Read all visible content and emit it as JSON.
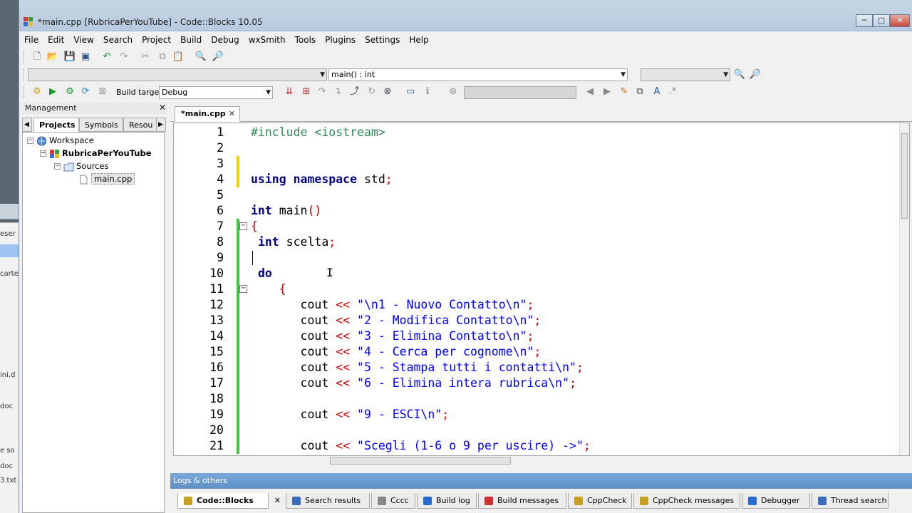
{
  "window": {
    "title": "*main.cpp [RubricaPerYouTube] - Code::Blocks 10.05",
    "min": "─",
    "max": "□",
    "close": "✕"
  },
  "menu": [
    "File",
    "Edit",
    "View",
    "Search",
    "Project",
    "Build",
    "Debug",
    "wxSmith",
    "Tools",
    "Plugins",
    "Settings",
    "Help"
  ],
  "toolbar": {
    "scope_value": "",
    "function_value": "main() : int",
    "build_target_label": "Build target:",
    "build_target_value": "Debug"
  },
  "management": {
    "title": "Management",
    "close": "✕",
    "tabs": [
      "Projects",
      "Symbols",
      "Resou"
    ],
    "tree": {
      "workspace": "Workspace",
      "project": "RubricaPerYouTube",
      "folder": "Sources",
      "file": "main.cpp"
    }
  },
  "editor": {
    "tab_label": "*main.cpp",
    "tab_close": "✕"
  },
  "code_lines": [
    {
      "n": "1",
      "html": "<span class='pp'>#include &lt;iostream&gt;</span>",
      "chg": "",
      "fold": ""
    },
    {
      "n": "2",
      "html": "",
      "chg": "",
      "fold": ""
    },
    {
      "n": "3",
      "html": "",
      "chg": "#f0d000",
      "fold": ""
    },
    {
      "n": "4",
      "html": "<span class='kw'>using namespace</span> std<span class='op'>;</span>",
      "chg": "#f0d000",
      "fold": ""
    },
    {
      "n": "5",
      "html": "",
      "chg": "",
      "fold": ""
    },
    {
      "n": "6",
      "html": "<span class='kw'>int</span> main<span class='op'>()</span>",
      "chg": "",
      "fold": ""
    },
    {
      "n": "7",
      "html": "<span class='op'>{</span>",
      "chg": "#3cc83c",
      "fold": "⊟"
    },
    {
      "n": "8",
      "html": " <span class='kw'>int</span> scelta<span class='op'>;</span>",
      "chg": "#3cc83c",
      "fold": ""
    },
    {
      "n": "9",
      "html": "",
      "chg": "#3cc83c",
      "fold": ""
    },
    {
      "n": "10",
      "html": " <span class='kw'>do</span>",
      "chg": "#3cc83c",
      "fold": ""
    },
    {
      "n": "11",
      "html": "    <span class='op'>{</span>",
      "chg": "#3cc83c",
      "fold": "⊟"
    },
    {
      "n": "12",
      "html": "       cout <span class='op'>&lt;&lt;</span> <span class='str'>\"\\n1 - Nuovo Contatto\\n\"</span><span class='op'>;</span>",
      "chg": "#3cc83c",
      "fold": ""
    },
    {
      "n": "13",
      "html": "       cout <span class='op'>&lt;&lt;</span> <span class='str'>\"2 - Modifica Contatto\\n\"</span><span class='op'>;</span>",
      "chg": "#3cc83c",
      "fold": ""
    },
    {
      "n": "14",
      "html": "       cout <span class='op'>&lt;&lt;</span> <span class='str'>\"3 - Elimina Contatto\\n\"</span><span class='op'>;</span>",
      "chg": "#3cc83c",
      "fold": ""
    },
    {
      "n": "15",
      "html": "       cout <span class='op'>&lt;&lt;</span> <span class='str'>\"4 - Cerca per cognome\\n\"</span><span class='op'>;</span>",
      "chg": "#3cc83c",
      "fold": ""
    },
    {
      "n": "16",
      "html": "       cout <span class='op'>&lt;&lt;</span> <span class='str'>\"5 - Stampa tutti i contatti\\n\"</span><span class='op'>;</span>",
      "chg": "#3cc83c",
      "fold": ""
    },
    {
      "n": "17",
      "html": "       cout <span class='op'>&lt;&lt;</span> <span class='str'>\"6 - Elimina intera rubrica\\n\"</span><span class='op'>;</span>",
      "chg": "#3cc83c",
      "fold": ""
    },
    {
      "n": "18",
      "html": "",
      "chg": "#3cc83c",
      "fold": ""
    },
    {
      "n": "19",
      "html": "       cout <span class='op'>&lt;&lt;</span> <span class='str'>\"9 - ESCI\\n\"</span><span class='op'>;</span>",
      "chg": "#3cc83c",
      "fold": ""
    },
    {
      "n": "20",
      "html": "",
      "chg": "#3cc83c",
      "fold": ""
    },
    {
      "n": "21",
      "html": "       cout <span class='op'>&lt;&lt;</span> <span class='str'>\"Scegli (1-6 o 9 per uscire) -&gt;\"</span><span class='op'>;</span>",
      "chg": "#3cc83c",
      "fold": ""
    }
  ],
  "logs": {
    "title": "Logs & others",
    "tabs": [
      "Code::Blocks",
      "Search results",
      "Cccc",
      "Build log",
      "Build messages",
      "CppCheck",
      "CppCheck messages",
      "Debugger",
      "Thread search"
    ]
  },
  "desk_fragments": [
    "eser",
    "",
    "carte",
    "ini.d",
    "doc",
    "e so",
    "doc",
    "3.txt"
  ],
  "colors": {
    "keyword": "#00008b",
    "preprocessor": "#2e8b57",
    "operator": "#cc0000",
    "string": "#0000ff",
    "changed_saved": "#3cc83c",
    "changed_unsaved": "#f0d000",
    "logs_header": "#5e90c6"
  }
}
